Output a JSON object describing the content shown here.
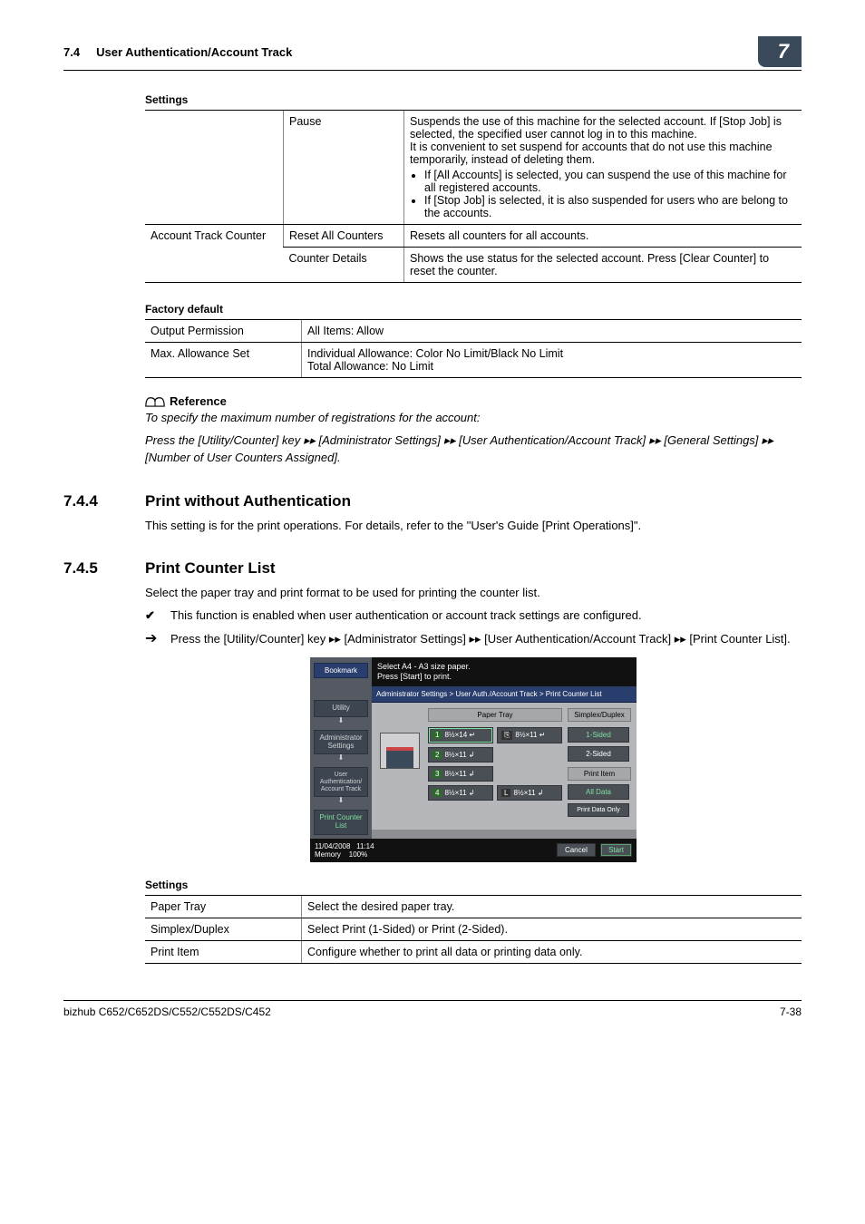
{
  "header": {
    "section_num": "7.4",
    "section_title": "User Authentication/Account Track",
    "chapter_num": "7"
  },
  "table1": {
    "caption": "Settings",
    "rows": [
      {
        "c1": "",
        "c2": "Pause",
        "c3_para": "Suspends the use of this machine for the selected account. If [Stop Job] is selected, the specified user cannot log in to this machine.\nIt is convenient to set suspend for accounts that do not use this machine temporarily, instead of deleting them.",
        "c3_bullets": [
          "If [All Accounts] is selected, you can suspend the use of this machine for all registered accounts.",
          "If [Stop Job] is selected, it is also suspended for users who are belong to the accounts."
        ]
      },
      {
        "c1": "Account Track Counter",
        "c2": "Reset All Counters",
        "c3": "Resets all counters for all accounts."
      },
      {
        "c1": "",
        "c2": "Counter Details",
        "c3": "Shows the use status for the selected account. Press [Clear Counter] to reset the counter."
      }
    ]
  },
  "table2": {
    "caption": "Factory default",
    "rows": [
      {
        "c1": "Output Permission",
        "c2": "All Items: Allow"
      },
      {
        "c1": "Max. Allowance Set",
        "c2": "Individual Allowance: Color No Limit/Black No Limit\nTotal Allowance: No Limit"
      }
    ]
  },
  "reference": {
    "heading": "Reference",
    "line1": "To specify the maximum number of registrations for the account:",
    "line2": "Press the [Utility/Counter] key ▸▸ [Administrator Settings] ▸▸ [User Authentication/Account Track] ▸▸ [General Settings] ▸▸ [Number of User Counters Assigned]."
  },
  "sec744": {
    "num": "7.4.4",
    "title": "Print without Authentication",
    "body": "This setting is for the print operations. For details, refer to the \"User's Guide [Print Operations]\"."
  },
  "sec745": {
    "num": "7.4.5",
    "title": "Print Counter List",
    "p1": "Select the paper tray and print format to be used for printing the counter list.",
    "check": "This function is enabled when user authentication or account track settings are configured.",
    "arrow": "Press the [Utility/Counter] key ▸▸ [Administrator Settings] ▸▸ [User Authentication/Account Track] ▸▸ [Print Counter List]."
  },
  "screenshot": {
    "top1": "Select A4 - A3 size paper.",
    "top2": "Press [Start] to print.",
    "bookmark": "Bookmark",
    "crumbs": {
      "utility": "Utility",
      "admin": "Administrator Settings",
      "userauth": "User Authentication/ Account Track",
      "pcl": "Print Counter List"
    },
    "breadcrumb": "Administrator Settings > User Auth./Account Track > Print Counter List",
    "col_paper": "Paper Tray",
    "col_sd": "Simplex/Duplex",
    "trays": {
      "t1": "8½×14 ↵",
      "t1b": "8½×11 ↵",
      "t2": "8½×11 ↲",
      "t3": "8½×11 ↲",
      "t4": "8½×11 ↲",
      "tL": "8½×11 ↲"
    },
    "sd": {
      "s1": "1-Sided",
      "s2": "2-Sided",
      "pi": "Print Item",
      "ad": "All Data",
      "pd": "Print Data Only"
    },
    "status_date": "11/04/2008",
    "status_time": "11:14",
    "status_mem_label": "Memory",
    "status_mem_val": "100%",
    "btn_cancel": "Cancel",
    "btn_start": "Start"
  },
  "table3": {
    "caption": "Settings",
    "rows": [
      {
        "c1": "Paper Tray",
        "c2": "Select the desired paper tray."
      },
      {
        "c1": "Simplex/Duplex",
        "c2": "Select Print (1-Sided) or Print (2-Sided)."
      },
      {
        "c1": "Print Item",
        "c2": "Configure whether to print all data or printing data only."
      }
    ]
  },
  "footer": {
    "left": "bizhub C652/C652DS/C552/C552DS/C452",
    "right": "7-38"
  }
}
